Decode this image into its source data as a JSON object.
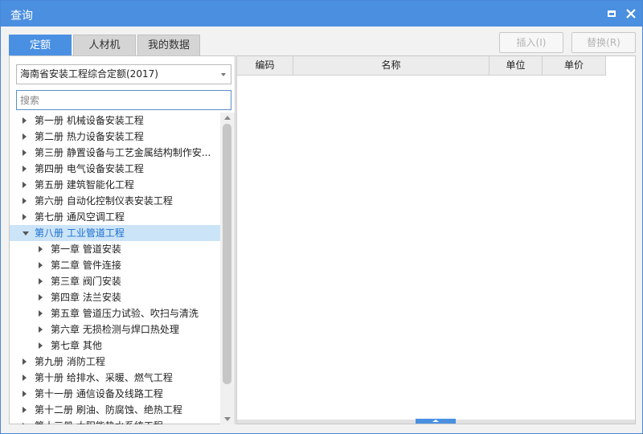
{
  "window": {
    "title": "查询",
    "colors": {
      "titlebar": "#4a8fe0",
      "accent": "#4a90e2",
      "selection": "#cce4f7"
    }
  },
  "tabs": [
    {
      "label": "定额",
      "active": true
    },
    {
      "label": "人材机",
      "active": false
    },
    {
      "label": "我的数据",
      "active": false
    }
  ],
  "actions": {
    "insert": "插入(I)",
    "replace": "替换(R)"
  },
  "left": {
    "library_selected": "海南省安装工程综合定额(2017)",
    "search_placeholder": "搜索",
    "tree": [
      {
        "label": "第一册 机械设备安装工程",
        "level": 0,
        "expanded": false,
        "selected": false
      },
      {
        "label": "第二册 热力设备安装工程",
        "level": 0,
        "expanded": false,
        "selected": false
      },
      {
        "label": "第三册 静置设备与工艺金属结构制作安...",
        "level": 0,
        "expanded": false,
        "selected": false
      },
      {
        "label": "第四册 电气设备安装工程",
        "level": 0,
        "expanded": false,
        "selected": false
      },
      {
        "label": "第五册 建筑智能化工程",
        "level": 0,
        "expanded": false,
        "selected": false
      },
      {
        "label": "第六册 自动化控制仪表安装工程",
        "level": 0,
        "expanded": false,
        "selected": false
      },
      {
        "label": "第七册 通风空调工程",
        "level": 0,
        "expanded": false,
        "selected": false
      },
      {
        "label": "第八册 工业管道工程",
        "level": 0,
        "expanded": true,
        "selected": true
      },
      {
        "label": "第一章 管道安装",
        "level": 1,
        "expanded": false,
        "selected": false
      },
      {
        "label": "第二章 管件连接",
        "level": 1,
        "expanded": false,
        "selected": false
      },
      {
        "label": "第三章 阀门安装",
        "level": 1,
        "expanded": false,
        "selected": false
      },
      {
        "label": "第四章 法兰安装",
        "level": 1,
        "expanded": false,
        "selected": false
      },
      {
        "label": "第五章 管道压力试验、吹扫与清洗",
        "level": 1,
        "expanded": false,
        "selected": false
      },
      {
        "label": "第六章 无损检测与焊口热处理",
        "level": 1,
        "expanded": false,
        "selected": false
      },
      {
        "label": "第七章 其他",
        "level": 1,
        "expanded": false,
        "selected": false
      },
      {
        "label": "第九册 消防工程",
        "level": 0,
        "expanded": false,
        "selected": false
      },
      {
        "label": "第十册 给排水、采暖、燃气工程",
        "level": 0,
        "expanded": false,
        "selected": false
      },
      {
        "label": "第十一册 通信设备及线路工程",
        "level": 0,
        "expanded": false,
        "selected": false
      },
      {
        "label": "第十二册 刷油、防腐蚀、绝热工程",
        "level": 0,
        "expanded": false,
        "selected": false
      },
      {
        "label": "第十三册 大阳能热水系统工程",
        "level": 0,
        "expanded": false,
        "selected": false
      }
    ]
  },
  "grid": {
    "columns": [
      "编码",
      "名称",
      "单位",
      "单价"
    ],
    "rows": []
  }
}
